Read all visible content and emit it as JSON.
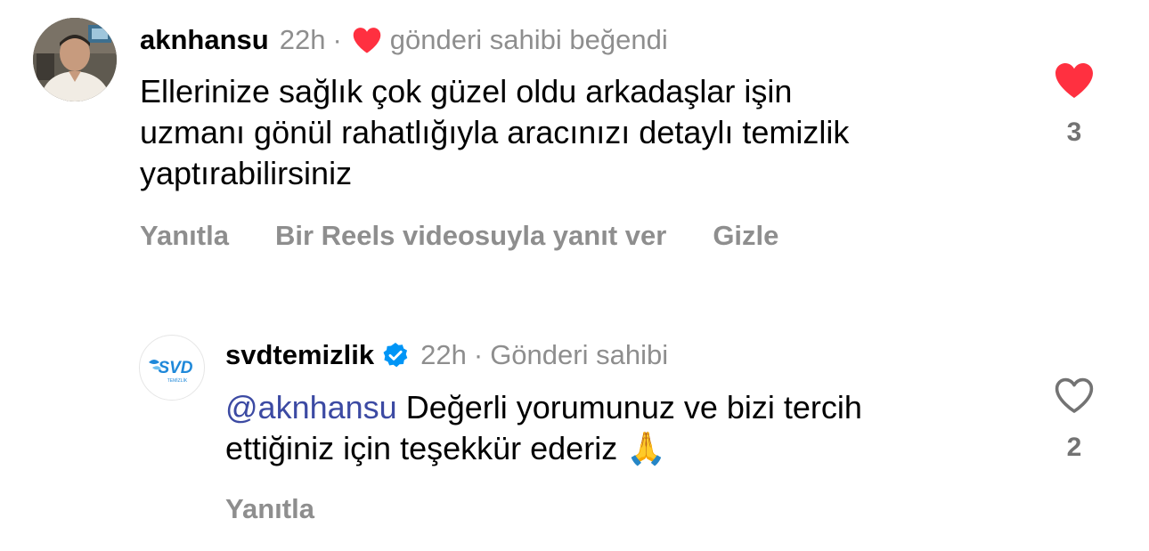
{
  "comments": [
    {
      "username": "aknhansu",
      "time": "22h",
      "separator": "·",
      "liked_by_author_text": "gönderi sahibi beğendi",
      "text_lines": [
        "Ellerinize sağlık çok güzel oldu arkadaşlar işin",
        "uzmanı gönül rahatlığıyla aracınızı detaylı temizlik",
        "yaptırabilirsiniz"
      ],
      "actions": {
        "reply": "Yanıtla",
        "reels_reply": "Bir Reels videosuyla yanıt ver",
        "hide": "Gizle"
      },
      "like_count": "3",
      "liked": true,
      "heart_color": "#ff3040"
    },
    {
      "username": "svdtemizlik",
      "verified": true,
      "time": "22h",
      "separator": "·",
      "author_badge": "Gönderi sahibi",
      "avatar_logo_text": "SVD",
      "avatar_logo_subtext": "TEMİZLİK",
      "mention": "@aknhansu",
      "text_line1_rest": "Değerli yorumunuz ve bizi tercih",
      "text_line2": "ettiğiniz için teşekkür ederiz",
      "emoji": "🙏",
      "actions": {
        "reply": "Yanıtla"
      },
      "like_count": "2",
      "liked": false,
      "verified_color": "#0095f6",
      "brand_color": "#1e88d9"
    }
  ]
}
